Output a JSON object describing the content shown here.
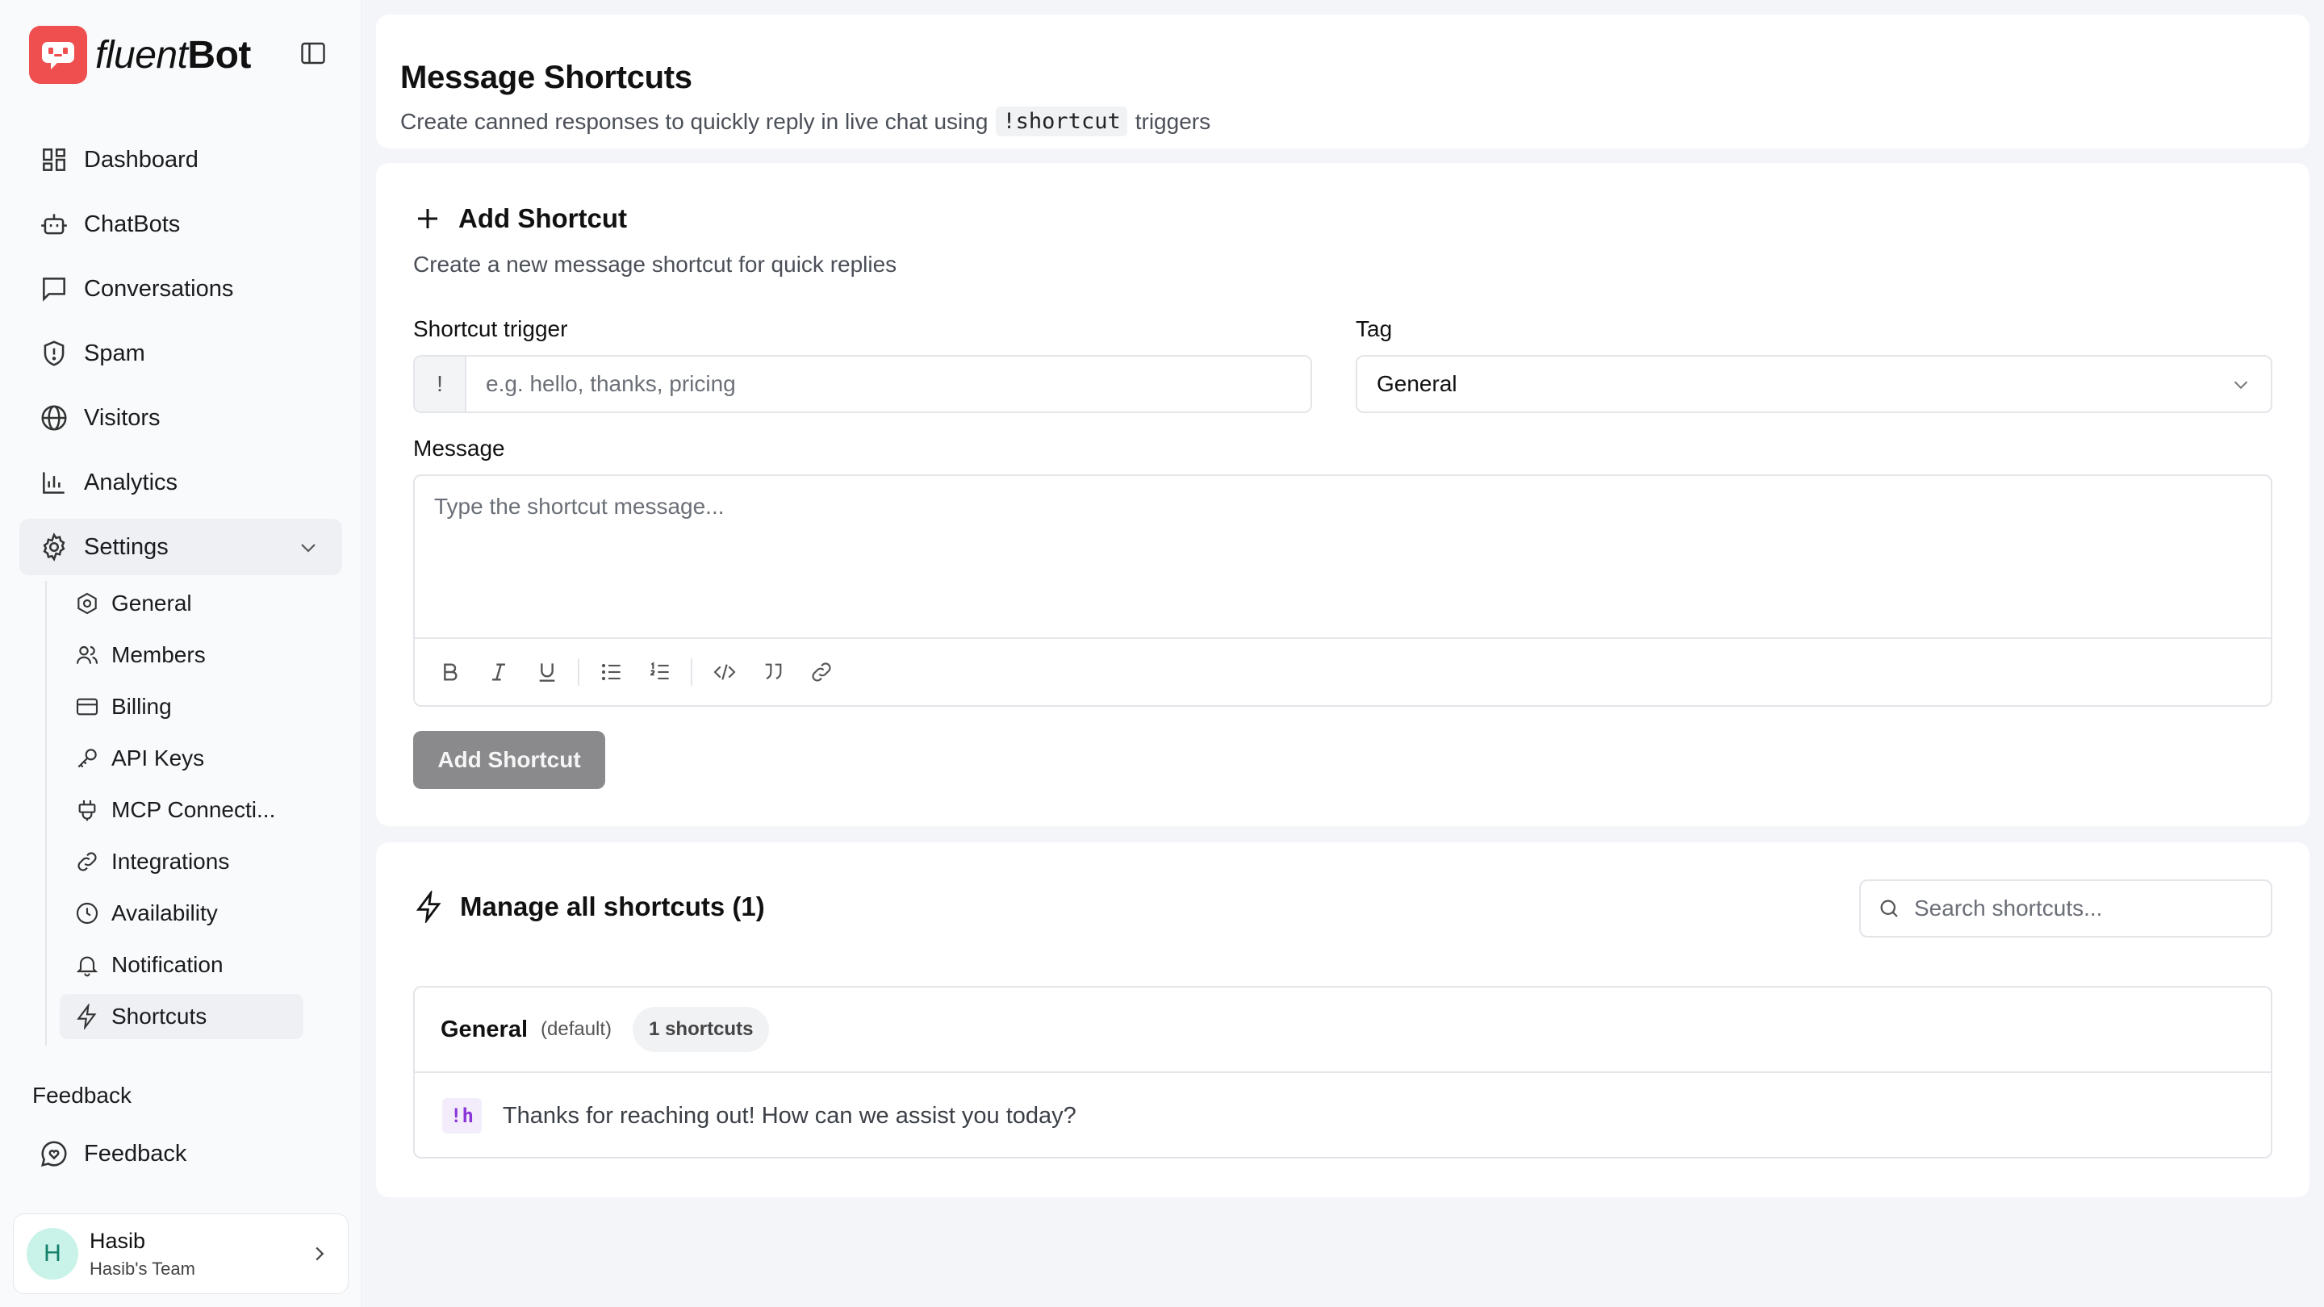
{
  "brand": {
    "name_part1": "fluent",
    "name_part2": "Bot",
    "accent": "#ef4f4f"
  },
  "nav": [
    {
      "label": "Dashboard",
      "icon": "dashboard-icon"
    },
    {
      "label": "ChatBots",
      "icon": "bot-icon"
    },
    {
      "label": "Conversations",
      "icon": "message-icon"
    },
    {
      "label": "Spam",
      "icon": "shield-icon"
    },
    {
      "label": "Visitors",
      "icon": "globe-icon"
    },
    {
      "label": "Analytics",
      "icon": "chart-icon"
    },
    {
      "label": "Settings",
      "icon": "gear-icon",
      "expanded": true
    }
  ],
  "settings_sub": [
    {
      "label": "General",
      "icon": "hexagon-gear-icon"
    },
    {
      "label": "Members",
      "icon": "users-icon"
    },
    {
      "label": "Billing",
      "icon": "credit-card-icon"
    },
    {
      "label": "API Keys",
      "icon": "key-icon"
    },
    {
      "label": "MCP Connecti...",
      "icon": "plug-icon"
    },
    {
      "label": "Integrations",
      "icon": "link-icon"
    },
    {
      "label": "Availability",
      "icon": "clock-icon"
    },
    {
      "label": "Notification",
      "icon": "bell-icon"
    },
    {
      "label": "Shortcuts",
      "icon": "lightning-icon",
      "active": true
    }
  ],
  "feedback": {
    "heading": "Feedback",
    "item_label": "Feedback"
  },
  "user": {
    "initial": "H",
    "name": "Hasib",
    "team": "Hasib's Team"
  },
  "header": {
    "title": "Message Shortcuts",
    "subtitle_before": "Create canned responses to quickly reply in live chat using",
    "subtitle_code": "!shortcut",
    "subtitle_after": "triggers"
  },
  "form": {
    "title": "Add Shortcut",
    "description": "Create a new message shortcut for quick replies",
    "trigger_label": "Shortcut trigger",
    "trigger_prefix": "!",
    "trigger_placeholder": "e.g. hello, thanks, pricing",
    "tag_label": "Tag",
    "tag_value": "General",
    "message_label": "Message",
    "message_placeholder": "Type the shortcut message...",
    "submit_label": "Add Shortcut"
  },
  "manage": {
    "title": "Manage all shortcuts (1)",
    "search_placeholder": "Search shortcuts...",
    "groups": [
      {
        "name": "General",
        "default_label": "(default)",
        "count_label": "1 shortcuts",
        "shortcuts": [
          {
            "key": "!h",
            "message": "Thanks for reaching out! How can we assist you today?"
          }
        ]
      }
    ]
  }
}
